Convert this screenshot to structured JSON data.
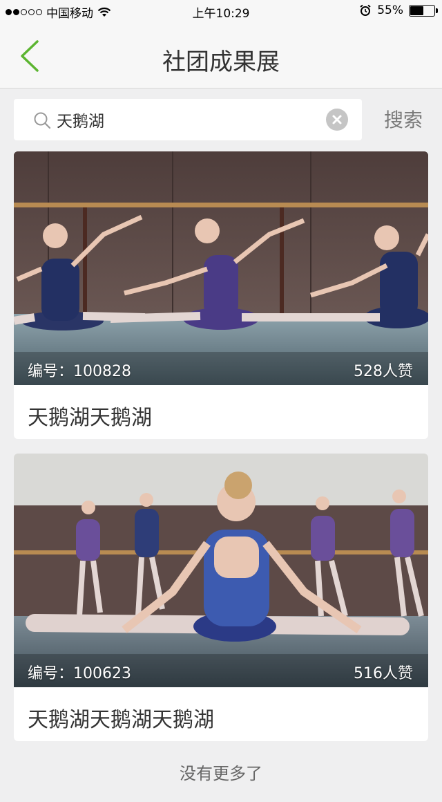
{
  "status_bar": {
    "carrier": "中国移动",
    "time": "上午10:29",
    "battery": "55%",
    "battery_level": 0.55
  },
  "nav": {
    "title": "社团成果展"
  },
  "search": {
    "value": "天鹅湖",
    "button_label": "搜索"
  },
  "results": [
    {
      "id_label": "编号：100828",
      "likes": "528人赞",
      "title": "天鹅湖天鹅湖"
    },
    {
      "id_label": "编号：100623",
      "likes": "516人赞",
      "title": "天鹅湖天鹅湖天鹅湖"
    }
  ],
  "footer": {
    "no_more": "没有更多了"
  },
  "colors": {
    "accent": "#5cb531",
    "background": "#efeff0"
  }
}
